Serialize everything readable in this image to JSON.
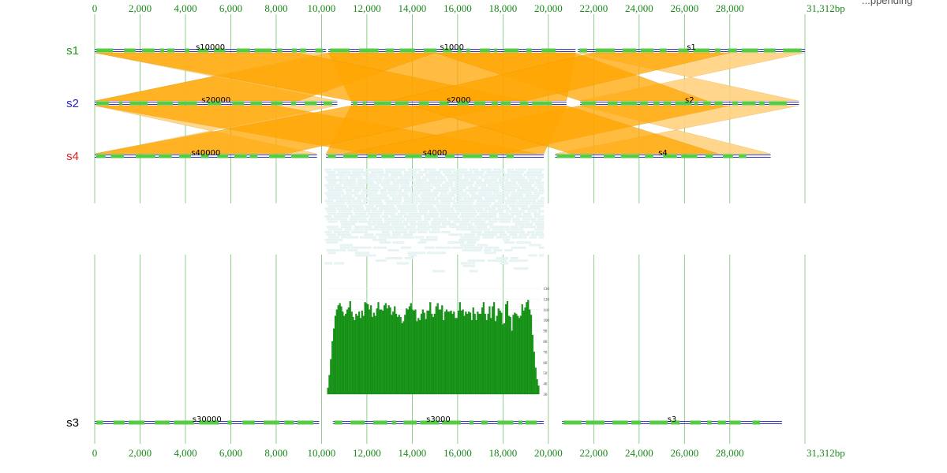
{
  "header_note": "...ppending",
  "axis": {
    "max_bp": 31312,
    "ticks": [
      0,
      2000,
      4000,
      6000,
      8000,
      10000,
      12000,
      14000,
      16000,
      18000,
      20000,
      22000,
      24000,
      26000,
      28000
    ],
    "tick_labels": [
      "0",
      "2,000",
      "4,000",
      "6,000",
      "8,000",
      "10,000",
      "12,000",
      "14,000",
      "16,000",
      "18,000",
      "20,000",
      "22,000",
      "24,000",
      "26,000",
      "28,000"
    ],
    "end_label": "31,312bp"
  },
  "colors": {
    "axis": "#1a8a1a",
    "grid": "#6fc46f",
    "backbone": "#3333cc",
    "gene": "#55cc44",
    "link_dark": "#ffa500",
    "link_light": "#ffd27f",
    "reads": "#e8f4f4",
    "coverage": "#1a9a1a"
  },
  "tracks": [
    {
      "id": "s1",
      "label": "s1",
      "label_color": "#1a9a1a",
      "contigs": [
        {
          "name": "s10000",
          "start": 0,
          "end": 10200
        },
        {
          "name": "s1000",
          "start": 10300,
          "end": 21200
        },
        {
          "name": "s1",
          "start": 21300,
          "end": 31312
        }
      ]
    },
    {
      "id": "s2",
      "label": "s2",
      "label_color": "#2222cc",
      "contigs": [
        {
          "name": "s20000",
          "start": 0,
          "end": 10700
        },
        {
          "name": "s2000",
          "start": 11300,
          "end": 20800
        },
        {
          "name": "s2",
          "start": 21400,
          "end": 31050
        }
      ]
    },
    {
      "id": "s4",
      "label": "s4",
      "label_color": "#e02020",
      "contigs": [
        {
          "name": "s40000",
          "start": 0,
          "end": 9800
        },
        {
          "name": "s4000",
          "start": 10200,
          "end": 19800
        },
        {
          "name": "s4",
          "start": 20300,
          "end": 29800
        }
      ]
    },
    {
      "id": "s3",
      "label": "s3",
      "label_color": "#000000",
      "contigs": [
        {
          "name": "s30000",
          "start": 0,
          "end": 9900
        },
        {
          "name": "s3000",
          "start": 10500,
          "end": 19800
        },
        {
          "name": "s3",
          "start": 20600,
          "end": 30300
        }
      ]
    }
  ],
  "synteny": [
    {
      "from": "s1",
      "to": "s2",
      "links": [
        {
          "a": [
            0,
            10200
          ],
          "b": [
            0,
            10700
          ],
          "shade": "light",
          "inverted": true
        },
        {
          "a": [
            10300,
            21200
          ],
          "b": [
            11300,
            20800
          ],
          "shade": "dark",
          "inverted": false
        },
        {
          "a": [
            21300,
            31312
          ],
          "b": [
            21400,
            31050
          ],
          "shade": "light",
          "inverted": true
        },
        {
          "a": [
            10300,
            15000
          ],
          "b": [
            0,
            9000
          ],
          "shade": "dark",
          "inverted": false
        },
        {
          "a": [
            0,
            9000
          ],
          "b": [
            11300,
            19000
          ],
          "shade": "dark",
          "inverted": false
        },
        {
          "a": [
            15000,
            21200
          ],
          "b": [
            21400,
            27000
          ],
          "shade": "dark",
          "inverted": false
        },
        {
          "a": [
            22000,
            28000
          ],
          "b": [
            13000,
            19000
          ],
          "shade": "dark",
          "inverted": false
        }
      ]
    },
    {
      "from": "s2",
      "to": "s4",
      "links": [
        {
          "a": [
            0,
            10700
          ],
          "b": [
            0,
            9800
          ],
          "shade": "light",
          "inverted": true
        },
        {
          "a": [
            11300,
            20800
          ],
          "b": [
            10200,
            19800
          ],
          "shade": "dark",
          "inverted": false
        },
        {
          "a": [
            21400,
            31050
          ],
          "b": [
            20300,
            29800
          ],
          "shade": "light",
          "inverted": true
        },
        {
          "a": [
            0,
            8000
          ],
          "b": [
            12000,
            19500
          ],
          "shade": "dark",
          "inverted": false
        },
        {
          "a": [
            11300,
            18000
          ],
          "b": [
            0,
            8500
          ],
          "shade": "dark",
          "inverted": false
        },
        {
          "a": [
            21400,
            28000
          ],
          "b": [
            11000,
            18000
          ],
          "shade": "dark",
          "inverted": false
        },
        {
          "a": [
            14000,
            20800
          ],
          "b": [
            21000,
            27500
          ],
          "shade": "dark",
          "inverted": false
        }
      ]
    }
  ],
  "reads": {
    "start": 10150,
    "end": 19800
  },
  "coverage": {
    "start": 10250,
    "end": 19600,
    "ymin": 30,
    "ymax": 130,
    "y_ticks": [
      30,
      40,
      50,
      60,
      70,
      80,
      90,
      100,
      110,
      120,
      130
    ],
    "values": [
      36,
      48,
      63,
      80,
      92,
      104,
      110,
      114,
      116,
      113,
      108,
      104,
      106,
      110,
      112,
      118,
      108,
      103,
      100,
      106,
      104,
      108,
      102,
      109,
      104,
      117,
      116,
      115,
      110,
      114,
      103,
      107,
      104,
      111,
      117,
      110,
      110,
      109,
      114,
      116,
      111,
      114,
      112,
      105,
      108,
      113,
      106,
      103,
      105,
      103,
      97,
      99,
      105,
      111,
      110,
      113,
      116,
      110,
      109,
      110,
      99,
      102,
      100,
      106,
      110,
      107,
      101,
      109,
      109,
      117,
      106,
      103,
      106,
      113,
      116,
      110,
      110,
      114,
      100,
      108,
      110,
      108,
      108,
      109,
      106,
      108,
      102,
      102,
      109,
      117,
      109,
      110,
      104,
      108,
      106,
      108,
      107,
      100,
      112,
      106,
      100,
      108,
      106,
      106,
      112,
      117,
      106,
      100,
      106,
      113,
      102,
      113,
      117,
      99,
      104,
      111,
      109,
      107,
      96,
      97,
      115,
      118,
      104,
      103,
      90,
      105,
      107,
      106,
      104,
      102,
      104,
      115,
      109,
      112,
      117,
      119,
      110,
      105,
      86,
      70,
      55,
      44,
      38
    ]
  }
}
